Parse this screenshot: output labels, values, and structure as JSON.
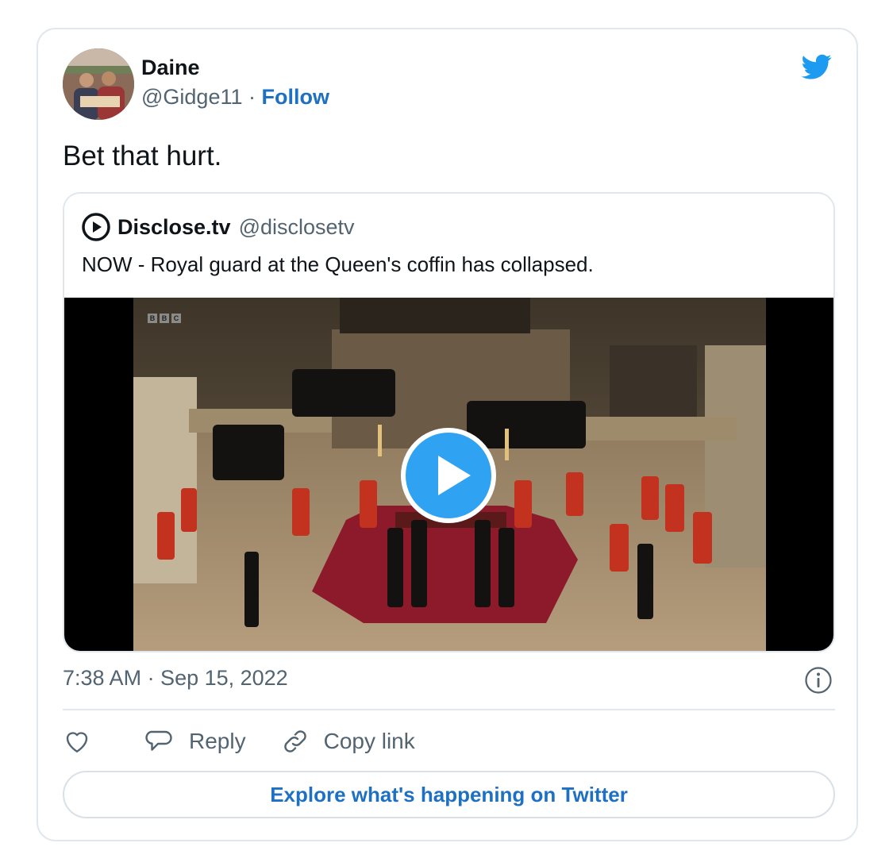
{
  "tweet": {
    "author_name": "Daine",
    "author_handle": "@Gidge11",
    "separator": "·",
    "follow_label": "Follow",
    "text": "Bet that hurt.",
    "timestamp": "7:38 AM · Sep 15, 2022"
  },
  "quoted_tweet": {
    "author_name": "Disclose.tv",
    "author_handle": "@disclosetv",
    "text": "NOW - Royal guard at the Queen's coffin has collapsed.",
    "media": {
      "type": "video",
      "watermark": [
        "B",
        "B",
        "C"
      ]
    }
  },
  "actions": {
    "like_label": "",
    "reply_label": "Reply",
    "copy_link_label": "Copy link"
  },
  "explore_label": "Explore what's happening on Twitter",
  "icons": {
    "brand": "twitter-bird-icon",
    "like": "heart-icon",
    "reply": "speech-bubble-icon",
    "copy_link": "link-icon",
    "info": "info-icon",
    "play": "play-icon"
  },
  "colors": {
    "accent": "#1d9bf0",
    "link": "#1d70c2",
    "secondary_text": "#536471",
    "border": "#e1e8ed"
  }
}
